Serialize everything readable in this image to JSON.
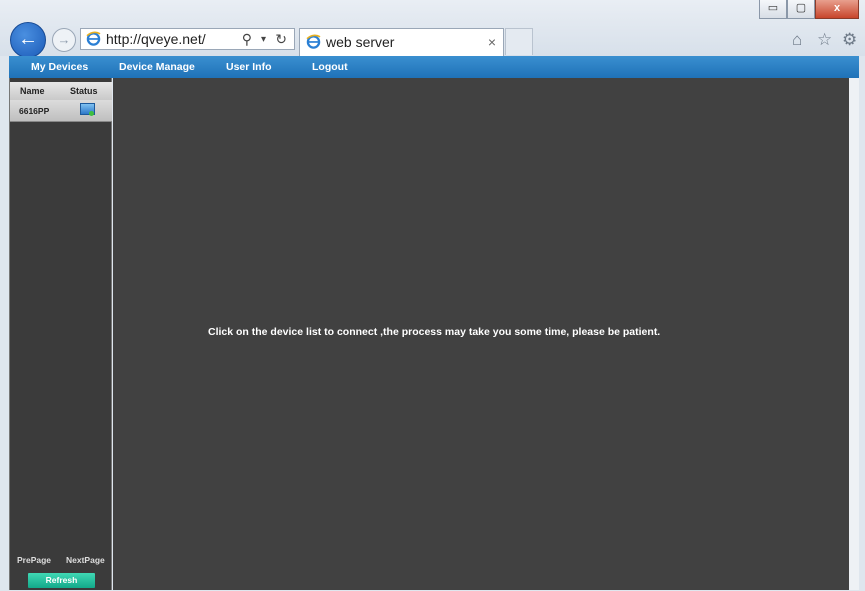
{
  "browser": {
    "url": "http://qveye.net/",
    "tab_title": "web server",
    "tab_close": "×",
    "window_buttons": {
      "minimize": "▭",
      "maximize": "▢",
      "close": "x"
    },
    "icons": [
      "home-icon",
      "star-icon",
      "gear-icon"
    ]
  },
  "menu": {
    "items": [
      {
        "label": "My Devices"
      },
      {
        "label": "Device Manage"
      },
      {
        "label": "User Info"
      },
      {
        "label": "Logout"
      }
    ]
  },
  "sidebar": {
    "columns": {
      "name": "Name",
      "status": "Status"
    },
    "devices": [
      {
        "name": "6616PP",
        "status_icon": "online-monitor-icon"
      }
    ],
    "prev_page": "PrePage",
    "next_page": "NextPage",
    "refresh": "Refresh"
  },
  "main": {
    "message": "Click on the device list to connect ,the process may take you some time, please be patient."
  },
  "colors": {
    "menubar": "#2a80c4",
    "panel_bg": "#414141",
    "refresh_button": "#22c09e"
  }
}
